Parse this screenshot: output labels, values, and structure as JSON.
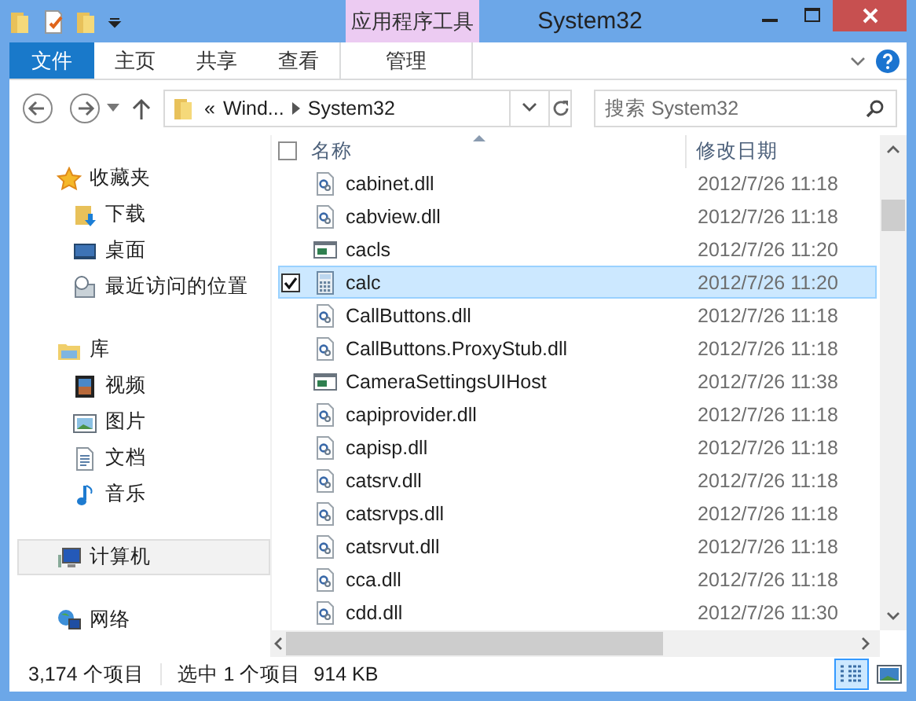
{
  "window": {
    "title": "System32",
    "contextual_group": "应用程序工具"
  },
  "ribbon_tabs": [
    {
      "label": "文件",
      "kind": "file"
    },
    {
      "label": "主页",
      "kind": "normal"
    },
    {
      "label": "共享",
      "kind": "normal"
    },
    {
      "label": "查看",
      "kind": "normal"
    },
    {
      "label": "管理",
      "kind": "contextual"
    }
  ],
  "address": {
    "overflow": "«",
    "segments": [
      "Wind...",
      "System32"
    ]
  },
  "search": {
    "placeholder": "搜索 System32"
  },
  "sidebar": [
    {
      "label": "收藏夹",
      "kind": "star",
      "selected": false,
      "children": [
        {
          "label": "下载",
          "kind": "download",
          "selected": false
        },
        {
          "label": "桌面",
          "kind": "desktop",
          "selected": false
        },
        {
          "label": "最近访问的位置",
          "kind": "recent",
          "selected": false
        }
      ]
    },
    {
      "label": "库",
      "kind": "library",
      "selected": false,
      "children": [
        {
          "label": "视频",
          "kind": "video",
          "selected": false
        },
        {
          "label": "图片",
          "kind": "picture",
          "selected": false
        },
        {
          "label": "文档",
          "kind": "document",
          "selected": false
        },
        {
          "label": "音乐",
          "kind": "music",
          "selected": false
        }
      ]
    },
    {
      "label": "计算机",
      "kind": "computer",
      "selected": true
    },
    {
      "label": "网络",
      "kind": "network",
      "selected": false
    }
  ],
  "columns": [
    "名称",
    "修改日期"
  ],
  "header_checkbox": {
    "checked": false
  },
  "rows": [
    {
      "name": "cabinet.dll",
      "date": "2012/7/26 11:18",
      "kind": "dll",
      "selected": false
    },
    {
      "name": "cabview.dll",
      "date": "2012/7/26 11:18",
      "kind": "dll",
      "selected": false
    },
    {
      "name": "cacls",
      "date": "2012/7/26 11:20",
      "kind": "exe",
      "selected": false
    },
    {
      "name": "calc",
      "date": "2012/7/26 11:20",
      "kind": "calc",
      "selected": true
    },
    {
      "name": "CallButtons.dll",
      "date": "2012/7/26 11:18",
      "kind": "dll",
      "selected": false
    },
    {
      "name": "CallButtons.ProxyStub.dll",
      "date": "2012/7/26 11:18",
      "kind": "dll",
      "selected": false
    },
    {
      "name": "CameraSettingsUIHost",
      "date": "2012/7/26 11:38",
      "kind": "exe",
      "selected": false
    },
    {
      "name": "capiprovider.dll",
      "date": "2012/7/26 11:18",
      "kind": "dll",
      "selected": false
    },
    {
      "name": "capisp.dll",
      "date": "2012/7/26 11:18",
      "kind": "dll",
      "selected": false
    },
    {
      "name": "catsrv.dll",
      "date": "2012/7/26 11:18",
      "kind": "dll",
      "selected": false
    },
    {
      "name": "catsrvps.dll",
      "date": "2012/7/26 11:18",
      "kind": "dll",
      "selected": false
    },
    {
      "name": "catsrvut.dll",
      "date": "2012/7/26 11:18",
      "kind": "dll",
      "selected": false
    },
    {
      "name": "cca.dll",
      "date": "2012/7/26 11:18",
      "kind": "dll",
      "selected": false
    },
    {
      "name": "cdd.dll",
      "date": "2012/7/26 11:30",
      "kind": "dll",
      "selected": false
    }
  ],
  "status_bar": {
    "item_count": "3,174 个项目",
    "selection": "选中 1 个项目",
    "size": "914 KB"
  },
  "view_buttons": [
    {
      "kind": "details",
      "selected": true
    },
    {
      "kind": "large_icons",
      "selected": false
    }
  ]
}
